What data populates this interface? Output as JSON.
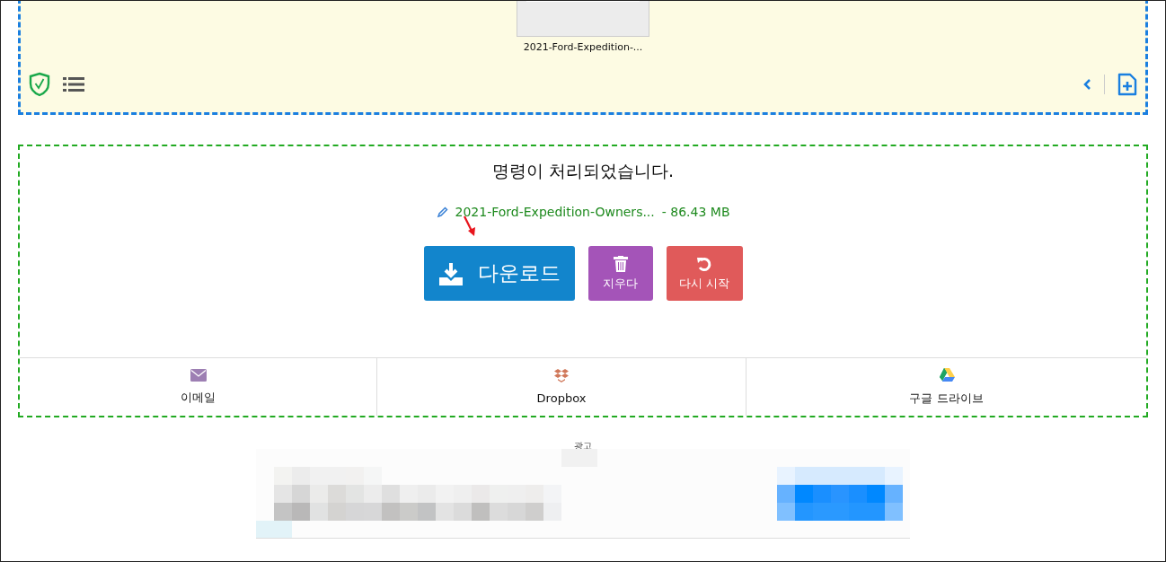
{
  "file_preview": {
    "name": "2021-Ford-Expedition-..."
  },
  "result": {
    "message": "명령이 처리되었습니다.",
    "file_name": "2021-Ford-Expedition-Owners...",
    "file_size": "- 86.43 MB"
  },
  "buttons": [
    {
      "kind": "download",
      "label": "다운로드"
    },
    {
      "kind": "delete",
      "label": "지우다"
    },
    {
      "kind": "restart",
      "label": "다시 시작"
    }
  ],
  "share": [
    {
      "kind": "email",
      "label": "이메일"
    },
    {
      "kind": "dropbox",
      "label": "Dropbox"
    },
    {
      "kind": "drive",
      "label": "구글 드라이브"
    }
  ],
  "ad": {
    "label": "광고",
    "kind": "picture"
  }
}
